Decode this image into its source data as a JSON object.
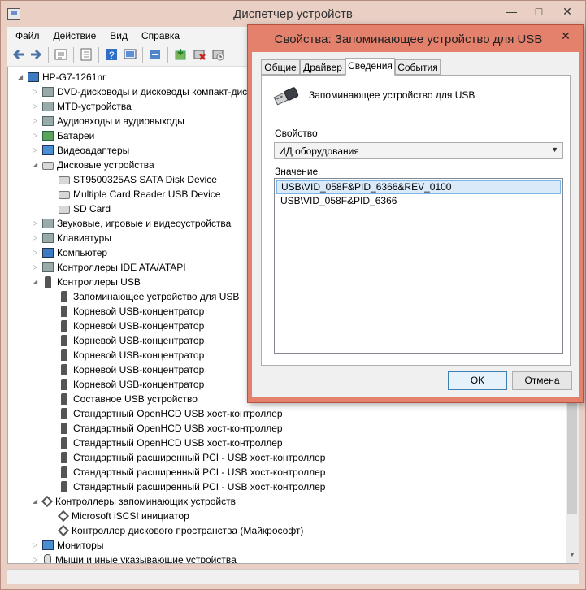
{
  "main_window": {
    "title": "Диспетчер устройств",
    "minimize": "—",
    "maximize": "□",
    "close": "✕"
  },
  "menu": [
    "Файл",
    "Действие",
    "Вид",
    "Справка"
  ],
  "toolbar_icons": [
    "back-icon",
    "forward-icon",
    "properties-icon",
    "update-icon",
    "help-icon",
    "scan-hardware-icon",
    "update-driver-icon",
    "uninstall-icon",
    "disable-icon"
  ],
  "tree": {
    "root": "HP-G7-1261nr",
    "rows": [
      {
        "text": "DVD-дисководы и дисководы компакт-дисков",
        "level": 1,
        "arrow": "▷",
        "icon": "dvd-drive-icon",
        "kind": "ic-gray"
      },
      {
        "text": "MTD-устройства",
        "level": 1,
        "arrow": "▷",
        "icon": "mtd-device-icon",
        "kind": "ic-gray"
      },
      {
        "text": "Аудиовходы и аудиовыходы",
        "level": 1,
        "arrow": "▷",
        "icon": "audio-io-icon",
        "kind": "ic-gray"
      },
      {
        "text": "Батареи",
        "level": 1,
        "arrow": "▷",
        "icon": "battery-icon",
        "kind": "ic-green"
      },
      {
        "text": "Видеоадаптеры",
        "level": 1,
        "arrow": "▷",
        "icon": "display-adapter-icon",
        "kind": "ic-blue"
      },
      {
        "text": "Дисковые устройства",
        "level": 1,
        "arrow": "◢",
        "icon": "disk-drives-icon",
        "kind": "ic-disk"
      },
      {
        "text": "ST9500325AS SATA Disk Device",
        "level": 2,
        "arrow": "",
        "icon": "disk-icon",
        "kind": "ic-disk"
      },
      {
        "text": "Multiple Card  Reader USB Device",
        "level": 2,
        "arrow": "",
        "icon": "disk-icon",
        "kind": "ic-disk"
      },
      {
        "text": "SD Card",
        "level": 2,
        "arrow": "",
        "icon": "disk-icon",
        "kind": "ic-disk"
      },
      {
        "text": "Звуковые, игровые и видеоустройства",
        "level": 1,
        "arrow": "▷",
        "icon": "speaker-icon",
        "kind": "ic-gray"
      },
      {
        "text": "Клавиатуры",
        "level": 1,
        "arrow": "▷",
        "icon": "keyboard-icon",
        "kind": "ic-gray"
      },
      {
        "text": "Компьютер",
        "level": 1,
        "arrow": "▷",
        "icon": "computer-icon",
        "kind": "ic-computer"
      },
      {
        "text": "Контроллеры IDE ATA/ATAPI",
        "level": 1,
        "arrow": "▷",
        "icon": "ide-controller-icon",
        "kind": "ic-gray"
      },
      {
        "text": "Контроллеры USB",
        "level": 1,
        "arrow": "◢",
        "icon": "usb-icon",
        "kind": "ic-usb"
      },
      {
        "text": "Запоминающее устройство для USB",
        "level": 2,
        "arrow": "",
        "icon": "usb-icon",
        "kind": "ic-usb"
      },
      {
        "text": "Корневой USB-концентратор",
        "level": 2,
        "arrow": "",
        "icon": "usb-icon",
        "kind": "ic-usb"
      },
      {
        "text": "Корневой USB-концентратор",
        "level": 2,
        "arrow": "",
        "icon": "usb-icon",
        "kind": "ic-usb"
      },
      {
        "text": "Корневой USB-концентратор",
        "level": 2,
        "arrow": "",
        "icon": "usb-icon",
        "kind": "ic-usb"
      },
      {
        "text": "Корневой USB-концентратор",
        "level": 2,
        "arrow": "",
        "icon": "usb-icon",
        "kind": "ic-usb"
      },
      {
        "text": "Корневой USB-концентратор",
        "level": 2,
        "arrow": "",
        "icon": "usb-icon",
        "kind": "ic-usb"
      },
      {
        "text": "Корневой USB-концентратор",
        "level": 2,
        "arrow": "",
        "icon": "usb-icon",
        "kind": "ic-usb"
      },
      {
        "text": "Составное USB устройство",
        "level": 2,
        "arrow": "",
        "icon": "usb-icon",
        "kind": "ic-usb"
      },
      {
        "text": "Стандартный OpenHCD USB хост-контроллер",
        "level": 2,
        "arrow": "",
        "icon": "usb-icon",
        "kind": "ic-usb"
      },
      {
        "text": "Стандартный OpenHCD USB хост-контроллер",
        "level": 2,
        "arrow": "",
        "icon": "usb-icon",
        "kind": "ic-usb"
      },
      {
        "text": "Стандартный OpenHCD USB хост-контроллер",
        "level": 2,
        "arrow": "",
        "icon": "usb-icon",
        "kind": "ic-usb"
      },
      {
        "text": "Стандартный расширенный PCI - USB хост-контроллер",
        "level": 2,
        "arrow": "",
        "icon": "usb-icon",
        "kind": "ic-usb"
      },
      {
        "text": "Стандартный расширенный PCI - USB хост-контроллер",
        "level": 2,
        "arrow": "",
        "icon": "usb-icon",
        "kind": "ic-usb"
      },
      {
        "text": "Стандартный расширенный PCI - USB хост-контроллер",
        "level": 2,
        "arrow": "",
        "icon": "usb-icon",
        "kind": "ic-usb"
      },
      {
        "text": "Контроллеры запоминающих устройств",
        "level": 1,
        "arrow": "◢",
        "icon": "storage-controller-icon",
        "kind": "ic-diamond"
      },
      {
        "text": "Microsoft iSCSI инициатор",
        "level": 2,
        "arrow": "",
        "icon": "storage-controller-icon",
        "kind": "ic-diamond"
      },
      {
        "text": "Контроллер дискового пространства (Майкрософт)",
        "level": 2,
        "arrow": "",
        "icon": "storage-controller-icon",
        "kind": "ic-diamond"
      },
      {
        "text": "Мониторы",
        "level": 1,
        "arrow": "▷",
        "icon": "monitor-icon",
        "kind": "ic-blue"
      },
      {
        "text": "Мыши и иные указывающие устройства",
        "level": 1,
        "arrow": "▷",
        "icon": "mouse-icon",
        "kind": "ic-mouse"
      }
    ]
  },
  "dialog": {
    "title": "Свойства: Запоминающее устройство для USB",
    "close": "✕",
    "tabs": [
      "Общие",
      "Драйвер",
      "Сведения",
      "События"
    ],
    "active_tab": "Сведения",
    "device_name": "Запоминающее устройство для USB",
    "property_label": "Свойство",
    "property_value": "ИД оборудования",
    "value_label": "Значение",
    "values": [
      "USB\\VID_058F&PID_6366&REV_0100",
      "USB\\VID_058F&PID_6366"
    ],
    "ok_label": "OK",
    "cancel_label": "Отмена"
  },
  "colors": {
    "dialog_frame": "#e4816d",
    "main_frame": "#e9cfc4",
    "selection": "#dbeaf9"
  }
}
